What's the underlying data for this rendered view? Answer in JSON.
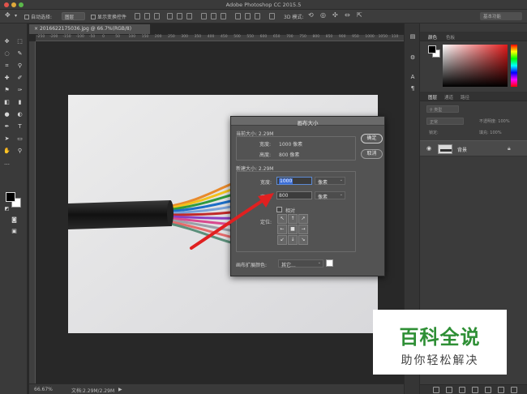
{
  "app": {
    "title": "Adobe Photoshop CC 2015.5"
  },
  "options_bar": {
    "auto_select_label": "自动选择:",
    "auto_select_value": "图层",
    "show_transform_label": "显示变换控件",
    "mode_3d_label": "3D 模式:",
    "workspace": "基本功能"
  },
  "document": {
    "tab_title": "2016622175036.jpg @ 66.7%(RGB/8)",
    "ruler_ticks": [
      "-250",
      "-200",
      "-150",
      "-100",
      "-50",
      "0",
      "50",
      "100",
      "150",
      "200",
      "250",
      "300",
      "350",
      "400",
      "450",
      "500",
      "550",
      "600",
      "650",
      "700",
      "750",
      "800",
      "850",
      "900",
      "950",
      "1000",
      "1050",
      "110"
    ]
  },
  "status": {
    "zoom": "66.67%",
    "doc_info": "文档:2.29M/2.29M"
  },
  "right_panel": {
    "color_tabs": [
      "颜色",
      "色板"
    ],
    "layer_tabs": [
      "图层",
      "通道",
      "路径"
    ],
    "kind_filter": "类型",
    "blend_mode": "正常",
    "opacity_label": "不透明度:",
    "opacity_value": "100%",
    "lock_label": "锁定:",
    "fill_label": "填充:",
    "fill_value": "100%",
    "layer_name": "背景"
  },
  "dialog": {
    "title": "画布大小",
    "current_size_label": "当前大小: 2.29M",
    "current_width_label": "宽度:",
    "current_width_value": "1000 像素",
    "current_height_label": "高度:",
    "current_height_value": "800 像素",
    "new_size_label": "新建大小: 2.29M",
    "width_label": "宽度:",
    "width_value": "1000",
    "width_unit": "像素",
    "height_label": "高度:",
    "height_value": "800",
    "height_unit": "像素",
    "relative_label": "相对",
    "anchor_label": "定位:",
    "anchor_arrows": [
      "↖",
      "↑",
      "↗",
      "←",
      "■",
      "→",
      "↙",
      "↓",
      "↘"
    ],
    "ext_color_label": "画布扩展颜色:",
    "ext_color_value": "其它...",
    "ok_label": "确定",
    "cancel_label": "取消"
  },
  "watermark": {
    "title": "百科全说",
    "subtitle": "助你轻松解决"
  }
}
